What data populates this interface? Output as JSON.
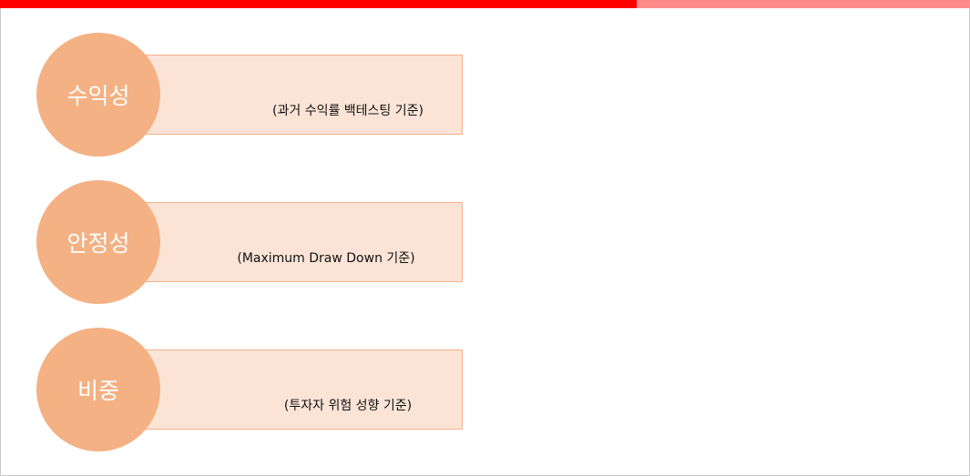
{
  "top_bar": {
    "dark_color": "#ff0000",
    "light_color": "#ff8a8a"
  },
  "items": [
    {
      "label": "수익성",
      "description": "(과거 수익률 백테스팅 기준)"
    },
    {
      "label": "안정성",
      "description": "(Maximum Draw Down 기준)"
    },
    {
      "label": "비중",
      "description": "(투자자 위험 성향 기준)"
    }
  ]
}
